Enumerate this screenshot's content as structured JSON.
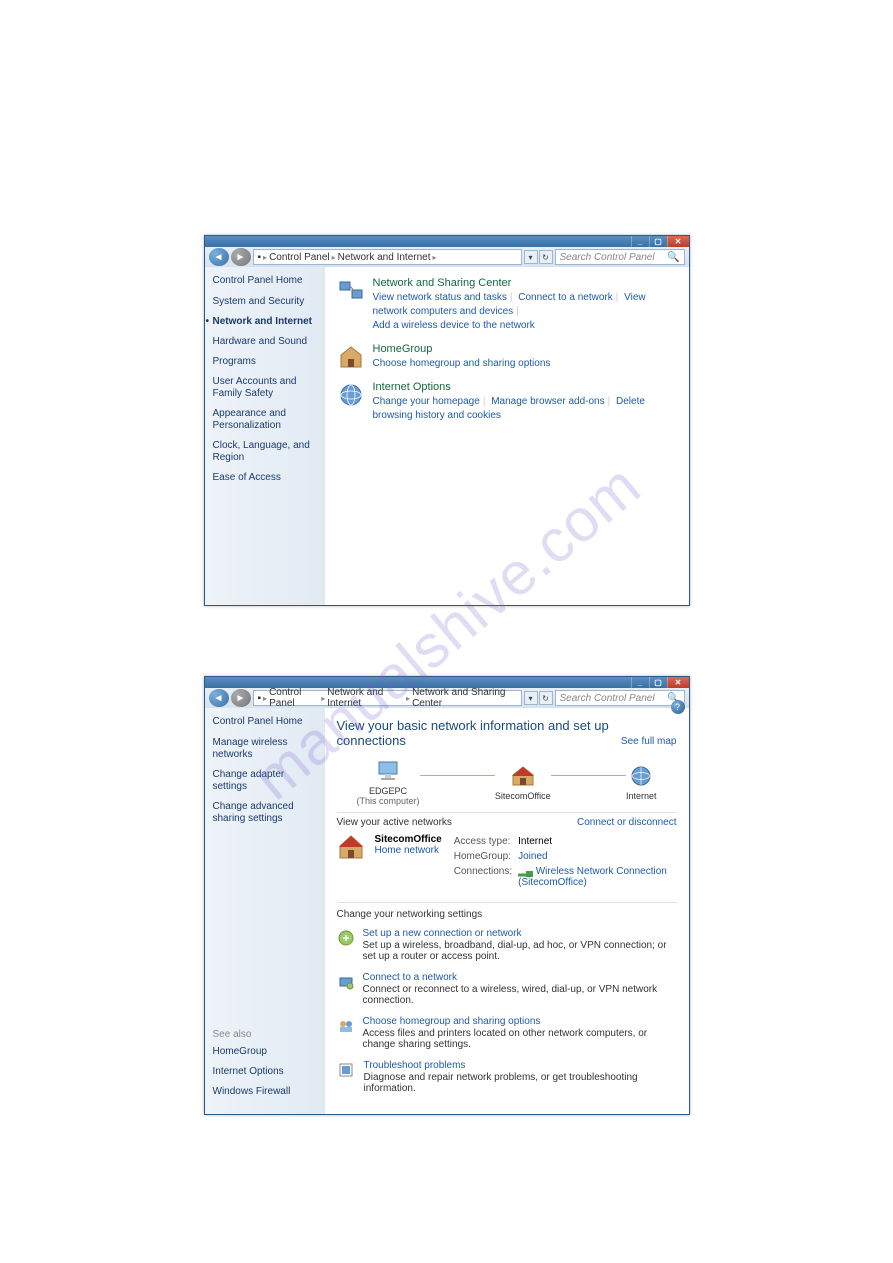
{
  "watermark": "manualshive.com",
  "win1": {
    "search_placeholder": "Search Control Panel",
    "crumbs": [
      "Control Panel",
      "Network and Internet"
    ],
    "sidebar": {
      "home": "Control Panel Home",
      "items": [
        "System and Security",
        "Network and Internet",
        "Hardware and Sound",
        "Programs",
        "User Accounts and Family Safety",
        "Appearance and Personalization",
        "Clock, Language, and Region",
        "Ease of Access"
      ]
    },
    "cats": [
      {
        "title": "Network and Sharing Center",
        "links": [
          "View network status and tasks",
          "Connect to a network",
          "View network computers and devices",
          "Add a wireless device to the network"
        ]
      },
      {
        "title": "HomeGroup",
        "links": [
          "Choose homegroup and sharing options"
        ]
      },
      {
        "title": "Internet Options",
        "links": [
          "Change your homepage",
          "Manage browser add-ons",
          "Delete browsing history and cookies"
        ]
      }
    ]
  },
  "win2": {
    "search_placeholder": "Search Control Panel",
    "crumbs": [
      "Control Panel",
      "Network and Internet",
      "Network and Sharing Center"
    ],
    "sidebar": {
      "home": "Control Panel Home",
      "items": [
        "Manage wireless networks",
        "Change adapter settings",
        "Change advanced sharing settings"
      ],
      "see_also_head": "See also",
      "see_also": [
        "HomeGroup",
        "Internet Options",
        "Windows Firewall"
      ]
    },
    "heading": "View your basic network information and set up connections",
    "full_map": "See full map",
    "nodes": [
      {
        "name": "EDGEPC",
        "sub": "(This computer)"
      },
      {
        "name": "SitecomOffice",
        "sub": ""
      },
      {
        "name": "Internet",
        "sub": ""
      }
    ],
    "active_head": "View your active networks",
    "disconnect": "Connect or disconnect",
    "net": {
      "name": "SitecomOffice",
      "type": "Home network",
      "props": [
        {
          "label": "Access type:",
          "value": "Internet",
          "link": false
        },
        {
          "label": "HomeGroup:",
          "value": "Joined",
          "link": true
        },
        {
          "label": "Connections:",
          "value": "Wireless Network Connection (SitecomOffice)",
          "link": true
        }
      ]
    },
    "change_head": "Change your networking settings",
    "tasks": [
      {
        "link": "Set up a new connection or network",
        "desc": "Set up a wireless, broadband, dial-up, ad hoc, or VPN connection; or set up a router or access point."
      },
      {
        "link": "Connect to a network",
        "desc": "Connect or reconnect to a wireless, wired, dial-up, or VPN network connection."
      },
      {
        "link": "Choose homegroup and sharing options",
        "desc": "Access files and printers located on other network computers, or change sharing settings."
      },
      {
        "link": "Troubleshoot problems",
        "desc": "Diagnose and repair network problems, or get troubleshooting information."
      }
    ]
  }
}
